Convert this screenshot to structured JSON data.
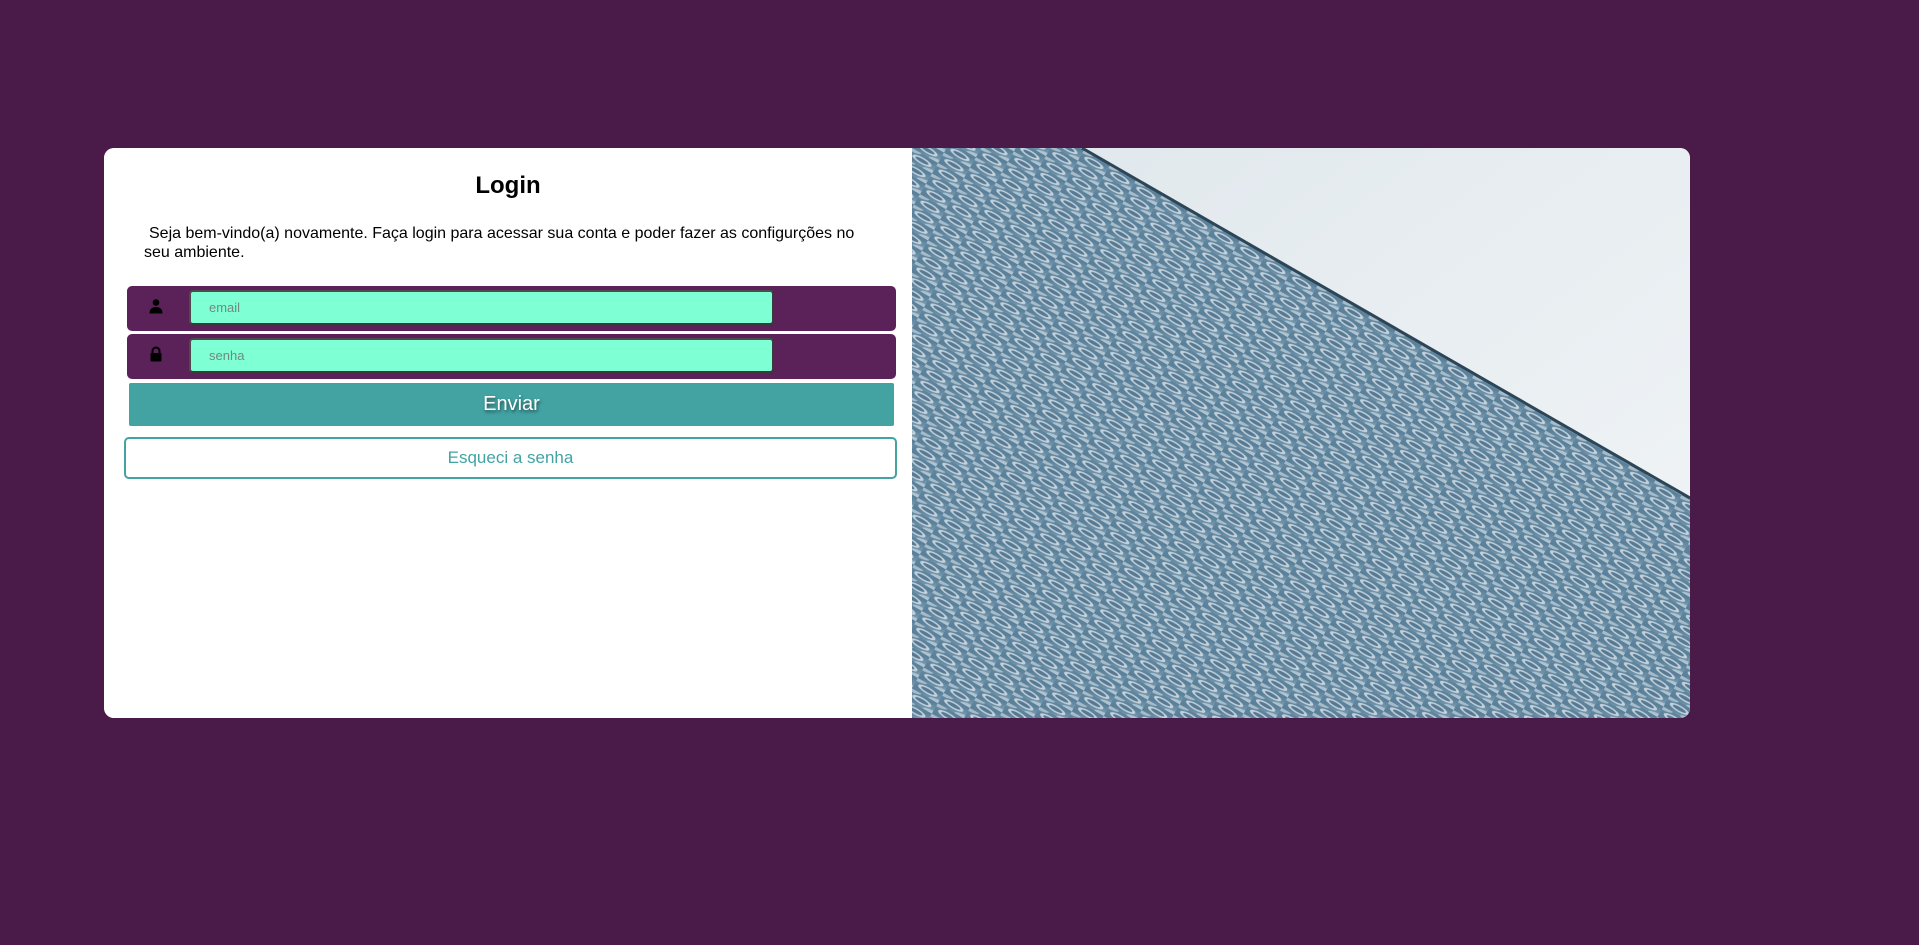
{
  "login": {
    "title": "Login",
    "intro": "Seja bem-vindo(a) novamente. Faça login para acessar sua conta e poder fazer as configurções no seu ambiente.",
    "email_placeholder": "email",
    "password_placeholder": "senha",
    "submit_label": "Enviar",
    "forgot_label": "Esqueci a senha"
  },
  "icons": {
    "email": "user-icon",
    "password": "lock-icon"
  },
  "colors": {
    "background": "#4a1a48",
    "field_row": "#5b2159",
    "input_fill": "#7fffd4",
    "accent": "#43a3a3"
  }
}
